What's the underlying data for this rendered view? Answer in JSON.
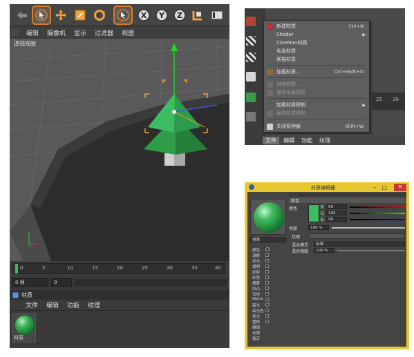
{
  "main_window": {
    "menu": [
      "编辑",
      "摄像机",
      "显示",
      "过滤器",
      "视图"
    ],
    "viewport_label": "透视视图",
    "timeline_ticks": [
      "0",
      "5",
      "10",
      "15",
      "20",
      "25",
      "30",
      "35",
      "40"
    ],
    "frame_field": "0 帧",
    "frame_field2": "0"
  },
  "material_panel": {
    "title": "材质",
    "menu": [
      "文件",
      "编辑",
      "功能",
      "纹理"
    ],
    "thumbnail_label": "材质"
  },
  "file_menu": {
    "items": [
      {
        "label": "新建材质",
        "shortcut": "Ctrl+N",
        "enabled": true
      },
      {
        "label": "Shader",
        "submenu": true,
        "enabled": true
      },
      {
        "label": "CineMan材质",
        "enabled": true
      },
      {
        "label": "毛发材质",
        "enabled": true
      },
      {
        "label": "素描材质",
        "enabled": true
      },
      {
        "label": "加载材质...",
        "shortcut": "Ctrl+Shift+O",
        "enabled": true
      },
      {
        "label": "另存材质...",
        "enabled": false
      },
      {
        "label": "保存全部材质",
        "enabled": false
      },
      {
        "label": "加载材质预制",
        "submenu": true,
        "enabled": true
      },
      {
        "label": "保存材质预制",
        "enabled": false
      },
      {
        "label": "关闭管理器",
        "shortcut": "Shift+W",
        "enabled": true
      }
    ],
    "bottom_menu": [
      "文件",
      "编辑",
      "功能",
      "纹理"
    ],
    "ruler_labels": [
      "25",
      "30"
    ]
  },
  "material_editor": {
    "title": "材质编辑器",
    "section_label": "颜色",
    "color_label": "颜色",
    "rgb": [
      {
        "channel": "R",
        "value": "59"
      },
      {
        "channel": "G",
        "value": "190"
      },
      {
        "channel": "B",
        "value": "98"
      }
    ],
    "brightness_label": "亮度",
    "brightness_value": "100 %",
    "texture_label": "纹理",
    "mix_mode_label": "混合模式",
    "mix_mode_value": "标准",
    "mix_strength_label": "混合强度",
    "mix_strength_value": "100 %",
    "material_name": "材质",
    "channels": [
      {
        "label": "颜色",
        "checked": true
      },
      {
        "label": "漫射",
        "checked": false
      },
      {
        "label": "发光",
        "checked": false
      },
      {
        "label": "透明",
        "checked": false
      },
      {
        "label": "反射",
        "checked": false
      },
      {
        "label": "环境",
        "checked": false
      },
      {
        "label": "烟雾",
        "checked": false
      },
      {
        "label": "凹凸",
        "checked": false
      },
      {
        "label": "法线",
        "checked": false
      },
      {
        "label": "Alpha",
        "checked": false
      },
      {
        "label": "高光",
        "checked": true
      },
      {
        "label": "高光色",
        "checked": false
      },
      {
        "label": "发光",
        "checked": false
      },
      {
        "label": "置换",
        "checked": false
      },
      {
        "label": "编辑",
        "checked": null
      },
      {
        "label": "光照",
        "checked": null
      },
      {
        "label": "指定",
        "checked": null
      }
    ]
  },
  "colors": {
    "accent_orange": "#e07a1f",
    "material_green": "#3bbe62",
    "editor_frame": "#e8c62f"
  }
}
